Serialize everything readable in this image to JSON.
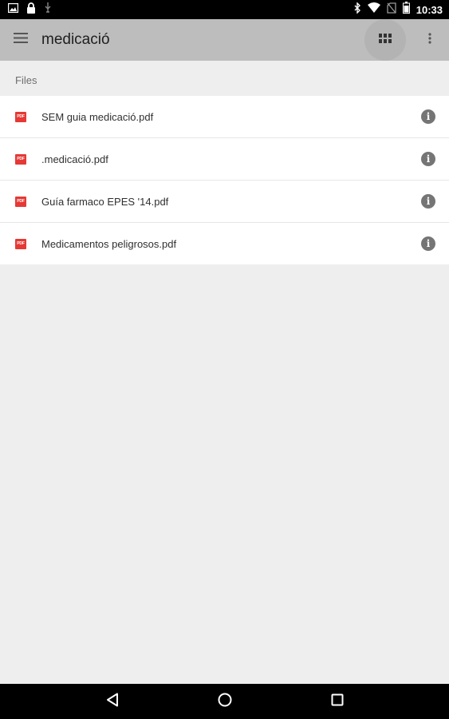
{
  "status_bar": {
    "time": "10:33",
    "icons_left": [
      "image-icon",
      "lock-icon",
      "usb-icon"
    ],
    "icons_right": [
      "bluetooth-icon",
      "wifi-icon",
      "no-sim-icon",
      "battery-icon"
    ]
  },
  "app_bar": {
    "title": "medicació",
    "menu_icon": "hamburger-menu-icon",
    "grid_icon": "grid-view-icon",
    "overflow_icon": "more-vertical-icon"
  },
  "section": {
    "header": "Files"
  },
  "files": [
    {
      "name": "SEM guia medicació.pdf",
      "type_label": "PDF"
    },
    {
      "name": ".medicació.pdf",
      "type_label": "PDF"
    },
    {
      "name": "Guía farmaco EPES '14.pdf",
      "type_label": "PDF"
    },
    {
      "name": "Medicamentos peligrosos.pdf",
      "type_label": "PDF"
    }
  ],
  "nav_bar": {
    "icons": [
      "back-icon",
      "home-icon",
      "recents-icon"
    ]
  },
  "colors": {
    "app_bar": "#bdbdbd",
    "background": "#eeeeee",
    "pdf_red": "#e53935",
    "info_grey": "#757575"
  }
}
